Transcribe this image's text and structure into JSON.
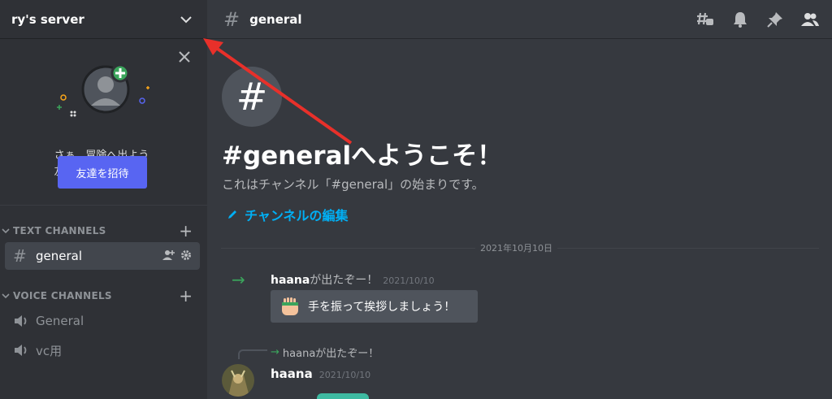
{
  "server": {
    "name": "ry's server"
  },
  "invite": {
    "line1": "さぁ、冒険へ出よう",
    "line2": "友達を追加しよう！",
    "button": "友達を招待"
  },
  "categories": {
    "text": "TEXT CHANNELS",
    "voice": "VOICE CHANNELS"
  },
  "text_channels": [
    {
      "name": "general"
    }
  ],
  "voice_channels": [
    {
      "name": "General"
    },
    {
      "name": "vc用"
    }
  ],
  "channel_header": {
    "hash": "#",
    "title": "general"
  },
  "welcome": {
    "title": "#generalへようこそ！",
    "subtitle": "これはチャンネル「#general」の始まりです。",
    "edit_link": "チャンネルの編集"
  },
  "date_divider": "2021年10月10日",
  "join_message": {
    "username": "haana",
    "text": "が出たぞー！",
    "timestamp": "2021/10/10",
    "wave_button": "手を振って挨拶しましょう！"
  },
  "reply": {
    "text": "haanaが出たぞー！"
  },
  "message": {
    "username": "haana",
    "timestamp": "2021/10/10"
  },
  "colors": {
    "accent": "#5865f2",
    "link": "#00aff4",
    "join_green": "#3ba55c",
    "annotation_red": "#e8302a"
  }
}
